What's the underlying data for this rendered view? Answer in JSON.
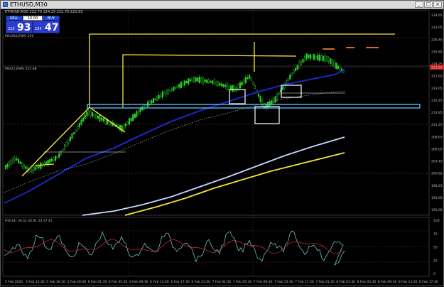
{
  "window": {
    "title": "ETHUSD,M30",
    "buttons": [
      "_",
      "□",
      "×"
    ]
  },
  "ticker": "ETHUSD,M30 222.70 224.23 222.70 223.93",
  "trade_panel": {
    "sell_label": "SELL",
    "buy_label": "BUY",
    "lot": "10.00",
    "sell_small": "223",
    "sell_big": "93",
    "buy_small": "224",
    "buy_big": "47"
  },
  "indicator_labels": {
    "ma1": "MA(200,EMA) 230",
    "ma2": "MA(21,EMA) 222.88",
    "rsi": "RSI(14) 36.42 40.91 54.37 41",
    "current_price": "223.93"
  },
  "price_axis": [
    "234.65",
    "232.05",
    "229.45",
    "226.85",
    "224.25",
    "221.65",
    "219.05",
    "216.45",
    "213.85",
    "211.25",
    "208.65",
    "206.05",
    "203.45",
    "200.85",
    "198.25",
    "195.65",
    "193.05"
  ],
  "rsi_axis": [
    "100",
    "75",
    "50",
    "25",
    "0"
  ],
  "time_axis": [
    "5 Feb 2020",
    "5 Feb 13:30",
    "5 Feb 16:30",
    "5 Feb 20:30",
    "6 Feb 01:30",
    "6 Feb 05:30",
    "6 Feb 09:30",
    "6 Feb 13:30",
    "6 Feb 17:30",
    "6 Feb 21:30",
    "7 Feb 01:30",
    "7 Feb 05:30",
    "7 Feb 09:30",
    "7 Feb 13:30",
    "7 Feb 17:30",
    "7 Feb 21:30",
    "8 Feb 01:30",
    "8 Feb 05:30",
    "8 Feb 09:30",
    "8 Feb 13:30",
    "8 Feb 17:30"
  ],
  "colors": {
    "background": "#000000",
    "bull_candle": "#2ad32a",
    "ma_fast": "#1c2ad8",
    "ma_slow": "#c8d8ff",
    "ma_yellow": "#f2e434",
    "annotation_yellow": "#f5ea3a",
    "support_blue": "#5ab8ee",
    "resistance_orange": "#f07a2a",
    "rsi_main": "#7fd7dc",
    "rsi_signal": "#d83030",
    "price_tag": "#d42222"
  }
}
